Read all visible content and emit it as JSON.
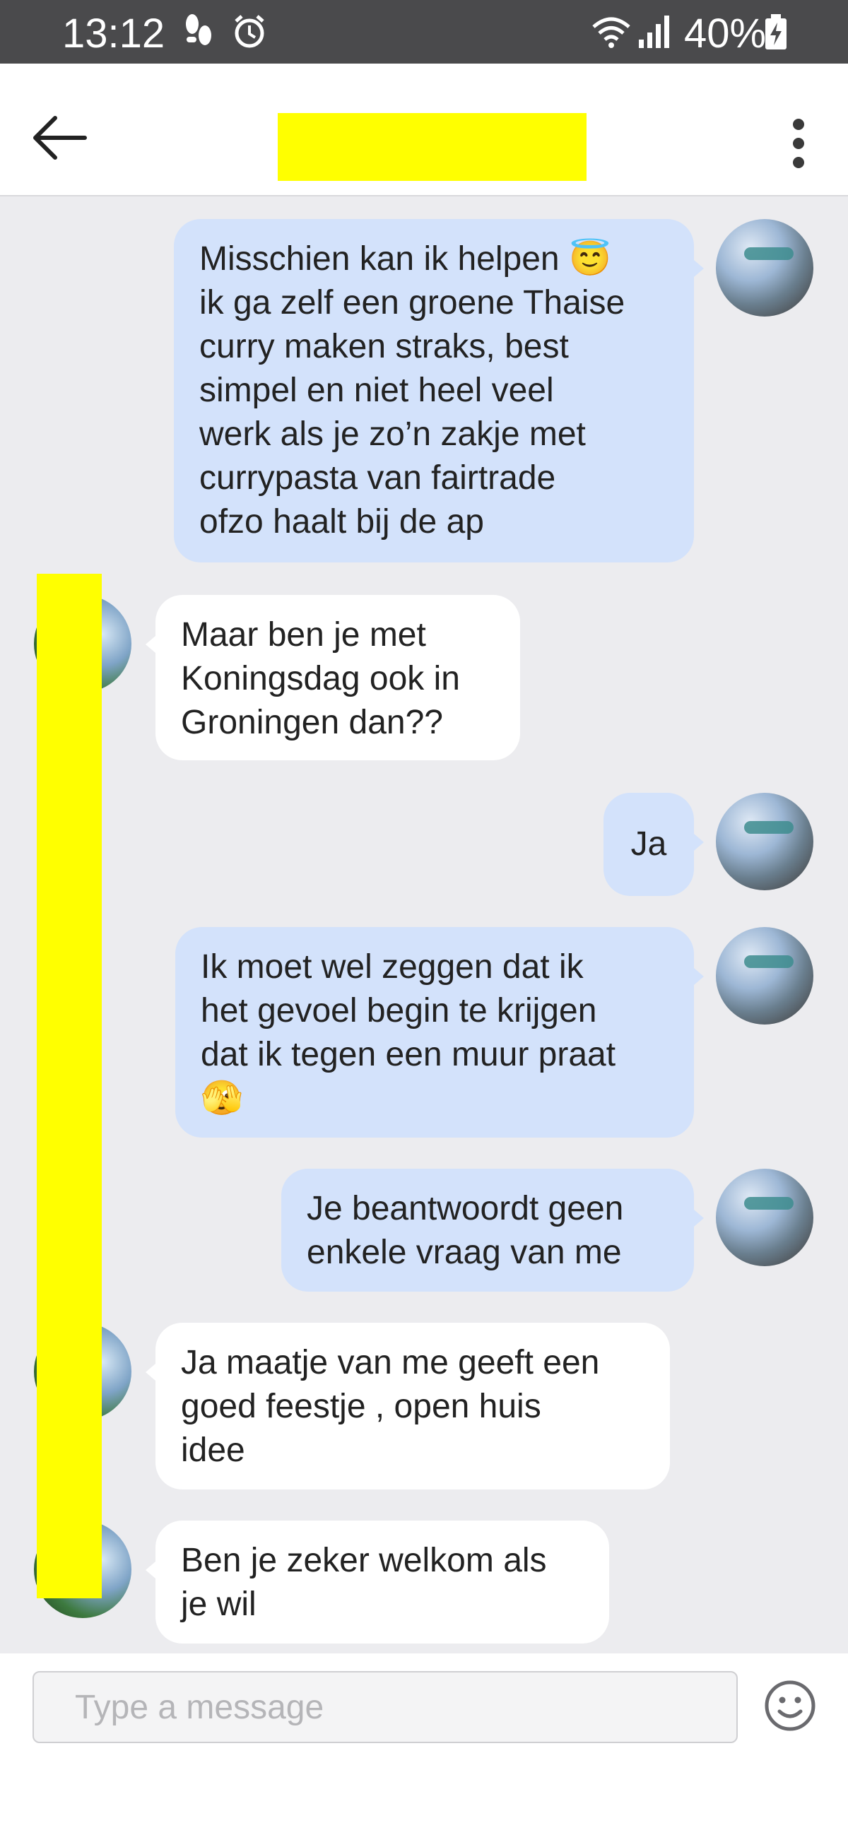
{
  "status_bar": {
    "time": "13:12",
    "battery_percent": "40%",
    "icons": [
      "footsteps-icon",
      "alarm-icon",
      "wifi-icon",
      "signal-icon",
      "battery-charging-icon"
    ]
  },
  "header": {
    "back_icon": "arrow-left-icon",
    "menu_icon": "more-vertical-icon"
  },
  "messages": [
    {
      "direction": "outgoing",
      "lines": [
        "Misschien kan ik helpen 😇",
        "ik ga zelf een groene Thaise",
        "curry maken straks, best",
        "simpel en niet heel veel",
        "werk als je zo’n zakje met",
        "currypasta van fairtrade",
        "ofzo haalt bij de ap"
      ]
    },
    {
      "direction": "incoming",
      "lines": [
        "Maar ben je met",
        "Koningsdag ook in",
        "Groningen dan??"
      ]
    },
    {
      "direction": "outgoing",
      "lines": [
        "Ja"
      ]
    },
    {
      "direction": "outgoing",
      "lines": [
        "Ik moet wel zeggen dat ik",
        "het gevoel begin te krijgen",
        "dat ik tegen een muur praat",
        "🫣"
      ]
    },
    {
      "direction": "outgoing",
      "lines": [
        "Je beantwoordt geen",
        "enkele vraag van me"
      ]
    },
    {
      "direction": "incoming",
      "lines": [
        "Ja maatje van me geeft een",
        "goed feestje , open huis",
        "idee"
      ]
    },
    {
      "direction": "incoming",
      "lines": [
        "Ben je zeker welkom als",
        "je wil"
      ]
    }
  ],
  "composer": {
    "placeholder": "Type a message",
    "value": "",
    "emoji_icon": "smiley-icon"
  },
  "colors": {
    "outgoing_bubble": "#d3e2fb",
    "incoming_bubble": "#ffffff",
    "chat_background": "#ececef",
    "redaction": "#ffff00",
    "status_bar": "#4a4a4c"
  }
}
